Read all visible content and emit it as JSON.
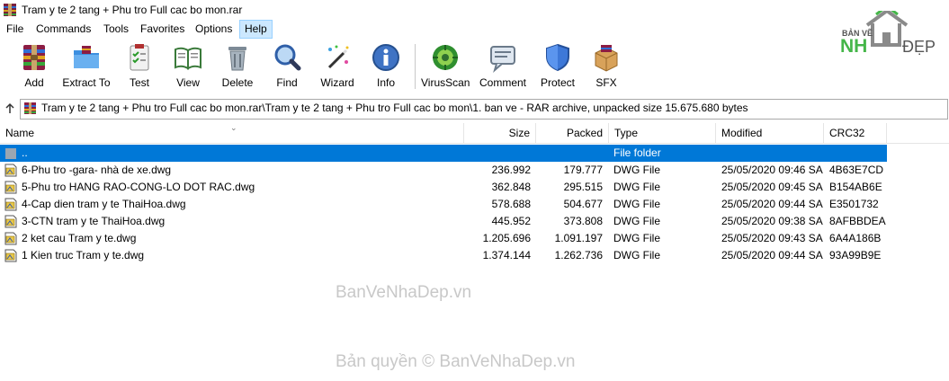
{
  "window": {
    "title": "Tram y te 2 tang + Phu tro Full cac bo mon.rar"
  },
  "menu": [
    "File",
    "Commands",
    "Tools",
    "Favorites",
    "Options",
    "Help"
  ],
  "toolbar": [
    {
      "label": "Add",
      "icon": "add-archive-icon"
    },
    {
      "label": "Extract To",
      "icon": "extract-folder-icon"
    },
    {
      "label": "Test",
      "icon": "test-clipboard-icon"
    },
    {
      "label": "View",
      "icon": "view-book-icon"
    },
    {
      "label": "Delete",
      "icon": "trash-icon"
    },
    {
      "label": "Find",
      "icon": "magnifier-icon"
    },
    {
      "label": "Wizard",
      "icon": "wizard-wand-icon"
    },
    {
      "label": "Info",
      "icon": "info-icon"
    },
    {
      "label": "VirusScan",
      "icon": "virus-scan-icon"
    },
    {
      "label": "Comment",
      "icon": "comment-icon"
    },
    {
      "label": "Protect",
      "icon": "shield-icon"
    },
    {
      "label": "SFX",
      "icon": "sfx-box-icon"
    }
  ],
  "logo": {
    "top_text": "BẢN VẼ",
    "brand_left": "NH",
    "brand_right": "ĐẸP"
  },
  "address": {
    "path": "Tram y te 2 tang + Phu tro Full cac bo mon.rar\\Tram y te 2 tang + Phu tro Full cac bo mon\\1. ban ve - RAR archive, unpacked size 15.675.680 bytes"
  },
  "columns": {
    "name": "Name",
    "size": "Size",
    "packed": "Packed",
    "type": "Type",
    "modified": "Modified",
    "crc": "CRC32"
  },
  "rows": [
    {
      "name": "..",
      "size": "",
      "packed": "",
      "type": "File folder",
      "modified": "",
      "crc": "",
      "selected": true
    },
    {
      "name": "6-Phu tro -gara- nhà de xe.dwg",
      "size": "236.992",
      "packed": "179.777",
      "type": "DWG File",
      "modified": "25/05/2020 09:46 SA",
      "crc": "4B63E7CD"
    },
    {
      "name": "5-Phu tro HANG RAO-CONG-LO DOT RAC.dwg",
      "size": "362.848",
      "packed": "295.515",
      "type": "DWG File",
      "modified": "25/05/2020 09:45 SA",
      "crc": "B154AB6E"
    },
    {
      "name": "4-Cap dien tram y te ThaiHoa.dwg",
      "size": "578.688",
      "packed": "504.677",
      "type": "DWG File",
      "modified": "25/05/2020 09:44 SA",
      "crc": "E3501732"
    },
    {
      "name": "3-CTN tram y te ThaiHoa.dwg",
      "size": "445.952",
      "packed": "373.808",
      "type": "DWG File",
      "modified": "25/05/2020 09:38 SA",
      "crc": "8AFBBDEA"
    },
    {
      "name": "2 ket cau Tram y te.dwg",
      "size": "1.205.696",
      "packed": "1.091.197",
      "type": "DWG File",
      "modified": "25/05/2020 09:43 SA",
      "crc": "6A4A186B"
    },
    {
      "name": "1 Kien truc Tram y te.dwg",
      "size": "1.374.144",
      "packed": "1.262.736",
      "type": "DWG File",
      "modified": "25/05/2020 09:44 SA",
      "crc": "93A99B9E"
    }
  ],
  "watermarks": [
    "BanVeNhaDep.vn",
    "Bản quyền © BanVeNhaDep.vn"
  ]
}
